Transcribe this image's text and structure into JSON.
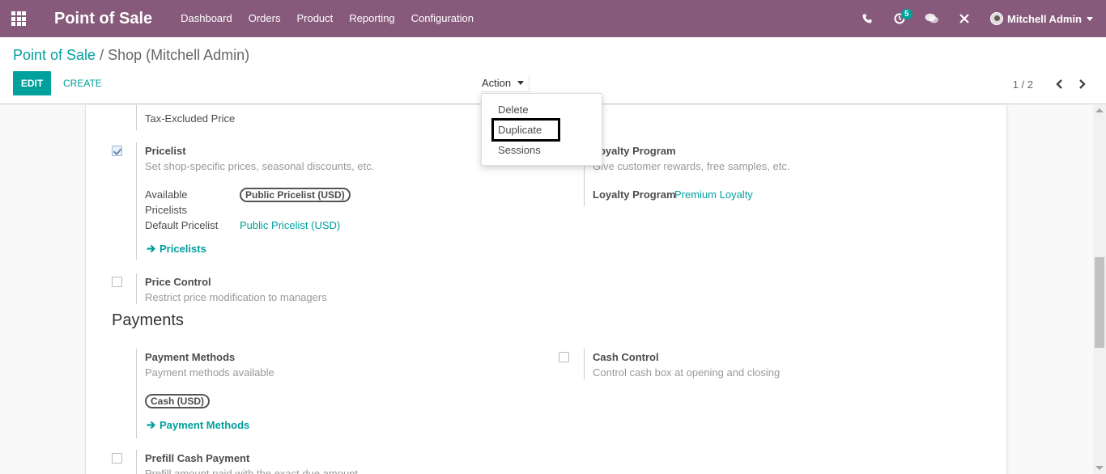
{
  "navbar": {
    "app_title": "Point of Sale",
    "menu": [
      "Dashboard",
      "Orders",
      "Product",
      "Reporting",
      "Configuration"
    ],
    "activity_count": "5",
    "user_name": "Mitchell Admin",
    "bg_color": "#875a7b"
  },
  "breadcrumb": {
    "parent": "Point of Sale",
    "separator": "/",
    "current": "Shop (Mitchell Admin)"
  },
  "toolbar": {
    "edit_label": "EDIT",
    "create_label": "CREATE",
    "action_label": "Action",
    "pager_value": "1 / 2"
  },
  "action_menu": {
    "items": [
      "Delete",
      "Duplicate",
      "Sessions"
    ],
    "highlighted": "Duplicate"
  },
  "form": {
    "tax_excluded": "Tax-Excluded Price",
    "pricelist": {
      "title": "Pricelist",
      "checked": true,
      "description": "Set shop-specific prices, seasonal discounts, etc.",
      "available_label_1": "Available",
      "available_label_2": "Pricelists",
      "available_tag": "Public Pricelist (USD)",
      "default_label": "Default Pricelist",
      "default_value": "Public Pricelist (USD)",
      "link": "Pricelists"
    },
    "loyalty": {
      "title": "Loyalty Program",
      "description": "Give customer rewards, free samples, etc.",
      "field_label": "Loyalty Program",
      "field_value": "Premium Loyalty"
    },
    "price_control": {
      "title": "Price Control",
      "checked": false,
      "description": "Restrict price modification to managers"
    },
    "payments_section": "Payments",
    "payment_methods": {
      "title": "Payment Methods",
      "description": "Payment methods available",
      "tag": "Cash (USD)",
      "link": "Payment Methods"
    },
    "cash_control": {
      "title": "Cash Control",
      "checked": false,
      "description": "Control cash box at opening and closing"
    },
    "prefill_cash": {
      "title": "Prefill Cash Payment",
      "checked": false,
      "description": "Prefill amount paid with the exact due amount"
    }
  },
  "colors": {
    "accent": "#00a09d",
    "brand": "#875a7b"
  },
  "icons": [
    "apps-grid-icon",
    "phone-icon",
    "activity-clock-icon",
    "chat-icon",
    "close-x-icon",
    "chevron-left-icon",
    "chevron-right-icon",
    "arrow-right-icon"
  ]
}
